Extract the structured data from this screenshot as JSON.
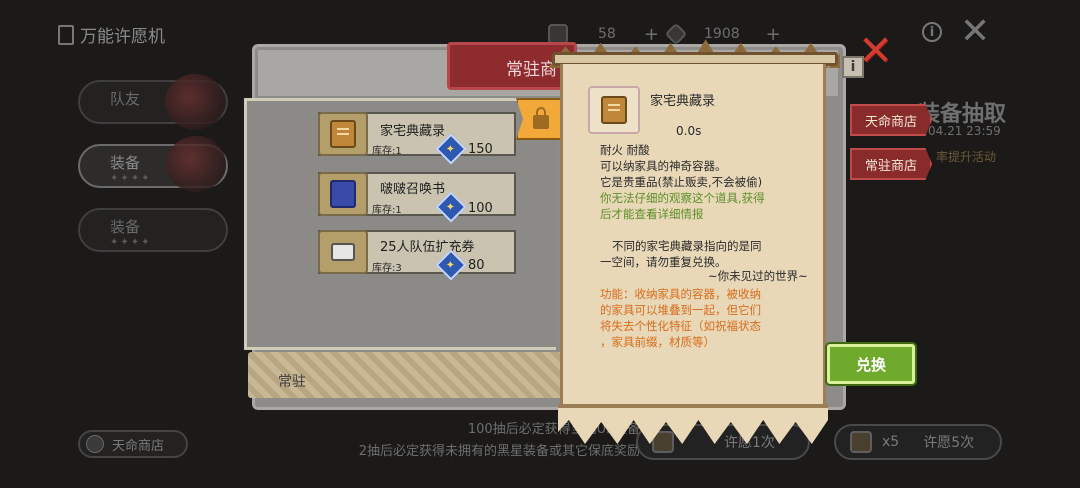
{
  "header": {
    "title": "万能许愿机",
    "currency": [
      {
        "value": "58",
        "icon": "ticket-icon"
      },
      {
        "value": "1908",
        "icon": "gem-icon"
      }
    ]
  },
  "sidebar": {
    "items": [
      {
        "label": "队友"
      },
      {
        "label": "装备"
      },
      {
        "label": "装备"
      }
    ]
  },
  "shop": {
    "tab_label": "常驻商",
    "footer_label": "常驻",
    "items": [
      {
        "name": "家宅典藏录",
        "stock": "库存:1",
        "price": "150"
      },
      {
        "name": "啵啵召唤书",
        "stock": "库存:1",
        "price": "100"
      },
      {
        "name": "25人队伍扩充券",
        "stock": "库存:3",
        "price": "80"
      }
    ]
  },
  "right_panel": {
    "title": "装备抽取",
    "date": "04.21 23:59",
    "activity": "率提升活动",
    "buttons": [
      "天命商店",
      "常驻商店"
    ]
  },
  "tooltip": {
    "name": "家宅典藏录",
    "time": "0.0s",
    "lines": [
      {
        "text": "耐火  耐酸",
        "color": "dark"
      },
      {
        "text": "可以纳家具的神奇容器。",
        "color": "dark"
      },
      {
        "text": "它是贵重品(禁止贩卖,不会被偷)",
        "color": "dark"
      },
      {
        "text": "你无法仔细的观察这个道具,获得",
        "color": "green"
      },
      {
        "text": "后才能查看详细情报",
        "color": "green"
      },
      {
        "text": "不同的家宅典藏录指向的是同",
        "color": "dark"
      },
      {
        "text": "一空间，请勿重复兑换。",
        "color": "dark"
      },
      {
        "text": "~你未见过的世界~",
        "color": "dark"
      },
      {
        "text": "功能：收纳家具的容器，被收纳",
        "color": "orange"
      },
      {
        "text": "的家具可以堆叠到一起，但它们",
        "color": "orange"
      },
      {
        "text": "将失去个性化特征（如祝福状态",
        "color": "orange"
      },
      {
        "text": "，家具前缀，材质等）",
        "color": "orange"
      }
    ],
    "exchange_label": "兑换"
  },
  "bottom": {
    "shop_button": "天命商店",
    "note_1": "100抽后必定获得当期UP装备",
    "note_2": "2抽后必定获得未拥有的黑星装备或其它保底奖励",
    "wish_1": "许愿1次",
    "wish_5_count": "x5",
    "wish_5": "许愿5次"
  },
  "colors": {
    "accent_red": "#8e2b2e",
    "exchange_green": "#6faa2d",
    "parchment": "#e8d8b8",
    "close_red": "#d53a30"
  }
}
